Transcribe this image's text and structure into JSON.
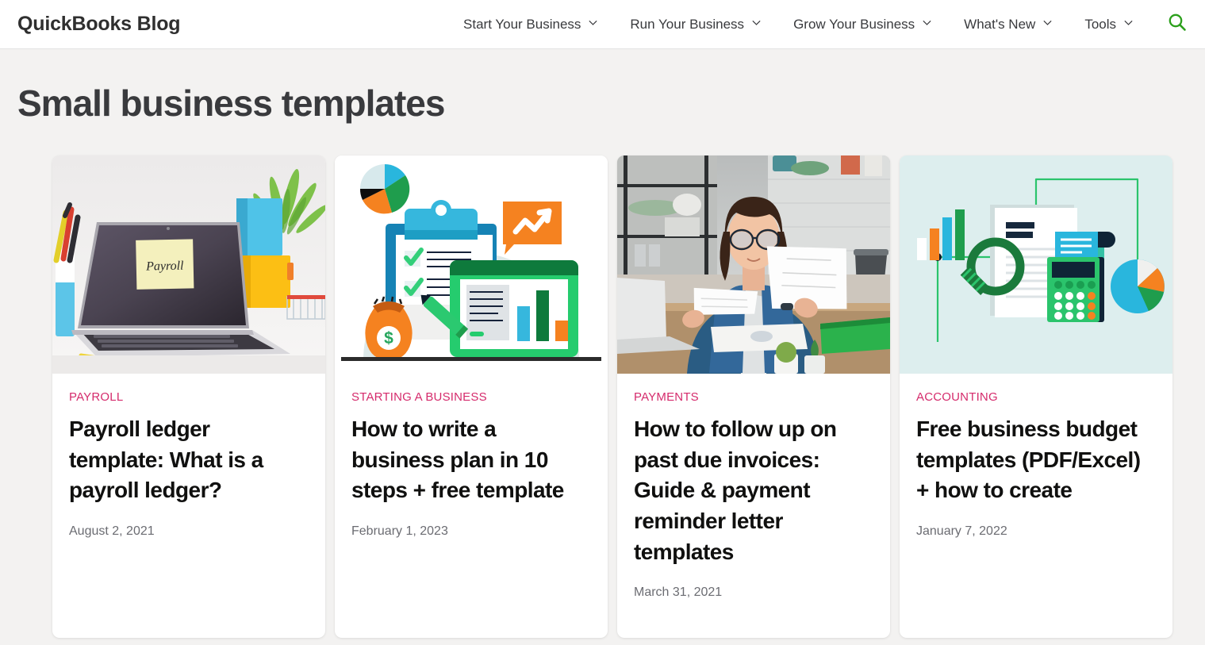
{
  "header": {
    "brand": "QuickBooks Blog",
    "nav_items": [
      {
        "label": "Start Your Business",
        "icon": "chevron-down-icon"
      },
      {
        "label": "Run Your Business",
        "icon": "chevron-down-icon"
      },
      {
        "label": "Grow Your Business",
        "icon": "chevron-down-icon"
      },
      {
        "label": "What's New",
        "icon": "chevron-down-icon"
      },
      {
        "label": "Tools",
        "icon": "chevron-down-icon"
      }
    ],
    "search_icon": "search-icon",
    "search_icon_color": "#2ca01c"
  },
  "page": {
    "title": "Small business templates",
    "background_color": "#f3f2f1",
    "category_color": "#d52b6c",
    "title_color": "#393a3d"
  },
  "cards": [
    {
      "category": "PAYROLL",
      "title": "Payroll ledger template: What is a payroll ledger?",
      "date": "August 2, 2021",
      "image_alt": "laptop-with-payroll-sticky-note-photo",
      "sticky_note_text": "Payroll"
    },
    {
      "category": "STARTING A BUSINESS",
      "title": "How to write a business plan in 10 steps + free template",
      "date": "February 1, 2023",
      "image_alt": "business-plan-clipboard-illustration"
    },
    {
      "category": "PAYMENTS",
      "title": "How to follow up on past due invoices: Guide & payment reminder letter templates",
      "date": "March 31, 2021",
      "image_alt": "woman-reviewing-invoices-photo"
    },
    {
      "category": "ACCOUNTING",
      "title": "Free business budget templates (PDF/Excel) + how to create",
      "date": "January 7, 2022",
      "image_alt": "budget-calculator-magnifier-illustration"
    }
  ]
}
